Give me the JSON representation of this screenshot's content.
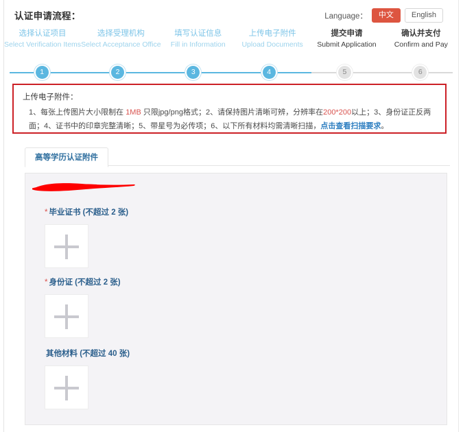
{
  "header": {
    "title": "认证申请流程：",
    "language_label": "Language：",
    "lang_zh": "中文",
    "lang_en": "English",
    "accent_active": "#dd5540"
  },
  "stepper": {
    "active_color": "#5bb7e0",
    "inactive_color": "#e2e2e2",
    "current_step": 4,
    "steps": [
      {
        "num": "1",
        "cn": "选择认证项目",
        "en": "Select Verification Items",
        "state": "done"
      },
      {
        "num": "2",
        "cn": "选择受理机构",
        "en": "Select Acceptance Office",
        "state": "done"
      },
      {
        "num": "3",
        "cn": "填写认证信息",
        "en": "Fill in Information",
        "state": "done"
      },
      {
        "num": "4",
        "cn": "上传电子附件",
        "en": "Upload Documents",
        "state": "done"
      },
      {
        "num": "5",
        "cn": "提交申请",
        "en": "Submit Application",
        "state": "todo"
      },
      {
        "num": "6",
        "cn": "确认并支付",
        "en": "Confirm and Pay",
        "state": "todo"
      }
    ]
  },
  "notice": {
    "border_color": "#cc2026",
    "title": "上传电子附件：",
    "seg_1": "1、每张上传图片大小限制在 ",
    "seg_1_hl": "1MB",
    "seg_2": " 只限jpg/png格式；2、请保持图片清晰可辨，分辨率在",
    "seg_2_hl": "200*200",
    "seg_3": "以上；3、身份证正反两面；4、证书中的印章完整清晰；5、带星号为必传项；6、以下所有材料均需清晰扫描，",
    "seg_link": "点击查看扫描要求",
    "seg_4": "。"
  },
  "tabs": [
    {
      "label": "高等学历认证附件",
      "active": true
    }
  ],
  "uploads": {
    "panel_bg": "#f4f3f6",
    "redaction_color": "#fe0000",
    "groups": [
      {
        "required": true,
        "star": "*",
        "label": "毕业证书 (不超过 2 张)",
        "max": 2,
        "plus_icon": "plus-icon"
      },
      {
        "required": true,
        "star": "*",
        "label": "身份证 (不超过 2 张)",
        "max": 2,
        "plus_icon": "plus-icon"
      },
      {
        "required": false,
        "star": "",
        "label": "其他材料 (不超过 40 张)",
        "max": 40,
        "plus_icon": "plus-icon"
      }
    ]
  }
}
